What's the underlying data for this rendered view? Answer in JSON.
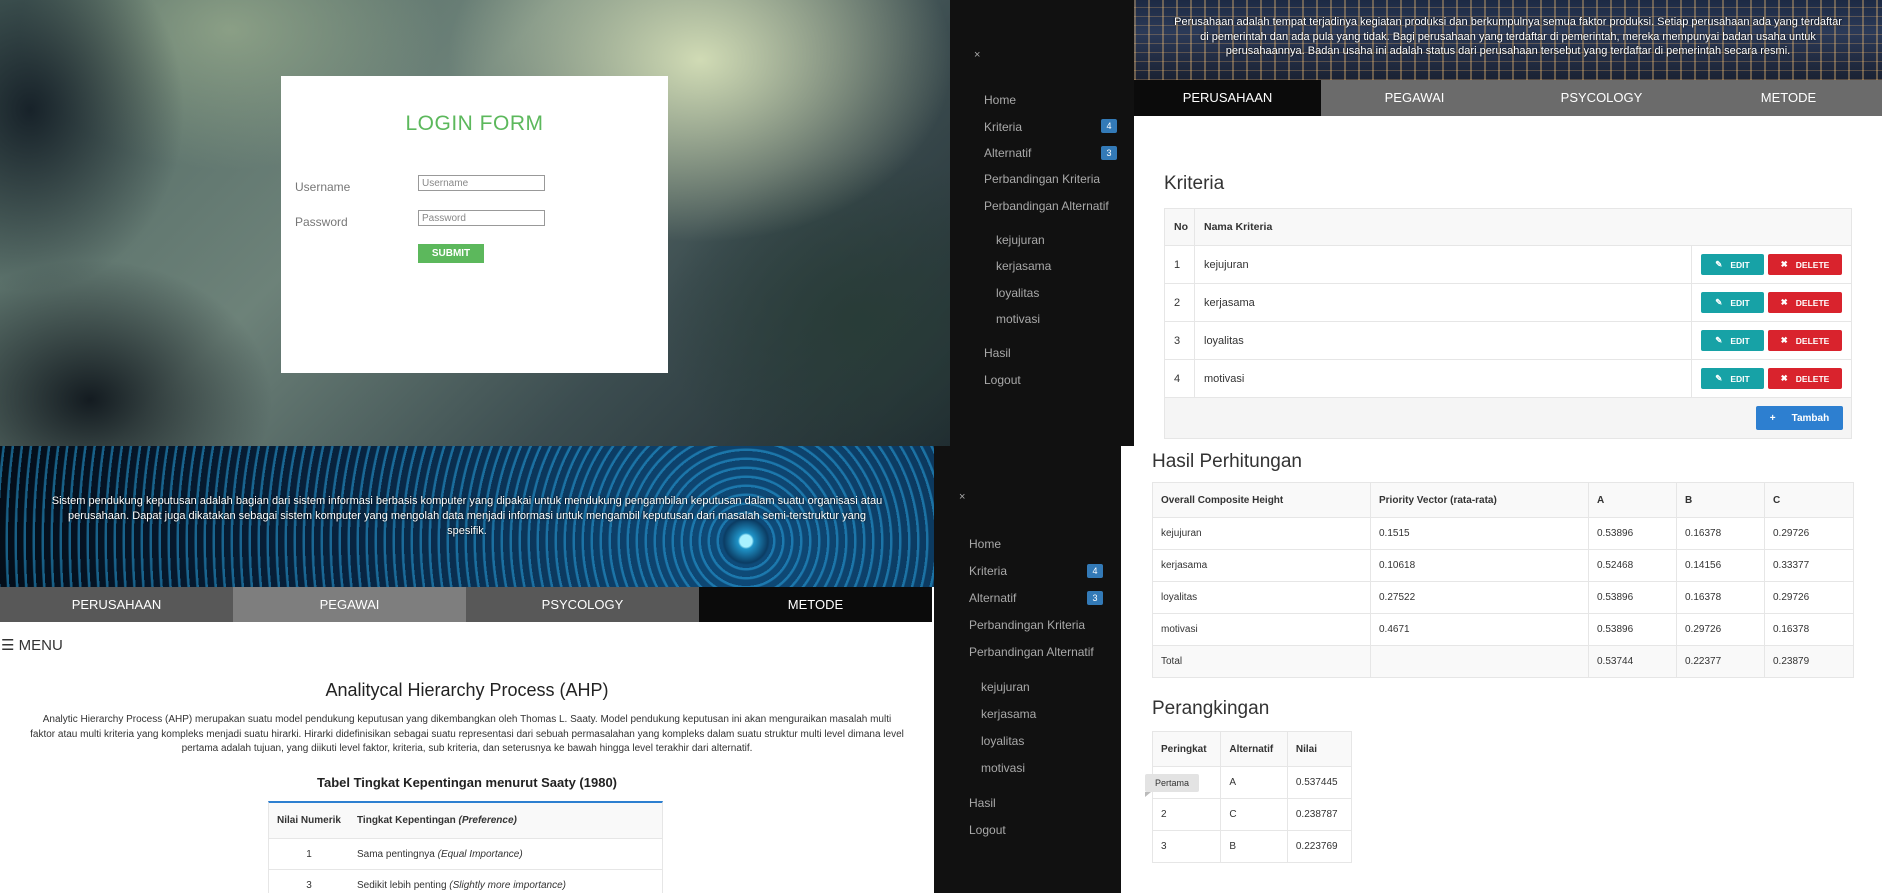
{
  "login": {
    "title": "LOGIN FORM",
    "username_label": "Username",
    "username_placeholder": "Username",
    "password_label": "Password",
    "password_placeholder": "Password",
    "submit_label": "SUBMIT",
    "accent_color": "#5cb85c"
  },
  "sidebar": {
    "close_symbol": "×",
    "items": [
      {
        "label": "Home"
      },
      {
        "label": "Kriteria",
        "badge": "4"
      },
      {
        "label": "Alternatif",
        "badge": "3"
      },
      {
        "label": "Perbandingan Kriteria"
      },
      {
        "label": "Perbandingan Alternatif"
      }
    ],
    "sub_items": [
      "kejujuran",
      "kerjasama",
      "loyalitas",
      "motivasi"
    ],
    "bottom_items": [
      "Hasil",
      "Logout"
    ],
    "badge_color": "#337ab7"
  },
  "tabs": [
    "PERUSAHAAN",
    "PEGAWAI",
    "PSYCOLOGY",
    "METODE"
  ],
  "kriteria_page": {
    "hero_text": "Perusahaan adalah tempat terjadinya kegiatan produksi dan berkumpulnya semua faktor produksi. Setiap perusahaan ada yang terdaftar di pemerintah dan ada pula yang tidak. Bagi perusahaan yang terdaftar di pemerintah, mereka mempunyai badan usaha untuk perusahaannya. Badan usaha ini adalah status dari perusahaan tersebut yang terdaftar di pemerintah secara resmi.",
    "title": "Kriteria",
    "col_no": "No",
    "col_name": "Nama Kriteria",
    "rows": [
      {
        "no": "1",
        "name": "kejujuran"
      },
      {
        "no": "2",
        "name": "kerjasama"
      },
      {
        "no": "3",
        "name": "loyalitas"
      },
      {
        "no": "4",
        "name": "motivasi"
      }
    ],
    "edit_label": "EDIT",
    "delete_label": "DELETE",
    "add_label": "Tambah",
    "edit_color": "#17a2a6",
    "delete_color": "#d9232d",
    "add_color": "#2d7fd0"
  },
  "ahp_page": {
    "hero_text": "Sistem pendukung keputusan adalah bagian dari sistem informasi berbasis komputer yang dipakai untuk mendukung pengambilan keputusan dalam suatu organisasi atau perusahaan. Dapat juga dikatakan sebagai sistem komputer yang mengolah data menjadi informasi untuk mengambil keputusan dari masalah semi-terstruktur yang spesifik.",
    "menu_label": "☰ MENU",
    "title": "Analitycal Hierarchy Process (AHP)",
    "description": "Analytic Hierarchy Process (AHP) merupakan suatu model pendukung keputusan yang dikembangkan oleh Thomas L. Saaty. Model pendukung keputusan ini akan menguraikan masalah multi faktor atau multi kriteria yang kompleks menjadi suatu hirarki. Hirarki didefinisikan sebagai suatu representasi dari sebuah permasalahan yang kompleks dalam suatu struktur multi level dimana level pertama adalah tujuan, yang diikuti level faktor, kriteria, sub kriteria, dan seterusnya ke bawah hingga level terakhir dari alternatif.",
    "table_title": "Tabel Tingkat Kepentingan menurut Saaty (1980)",
    "col_value": "Nilai Numerik",
    "col_importance": "Tingkat Kepentingan",
    "col_importance_en": "(Preference)",
    "rows": [
      {
        "value": "1",
        "label": "Sama pentingnya",
        "label_en": "(Equal Importance)"
      },
      {
        "value": "3",
        "label": "Sedikit lebih penting",
        "label_en": "(Slightly more importance)"
      }
    ]
  },
  "hasil_page": {
    "title": "Hasil Perhitungan",
    "headers": [
      "Overall Composite Height",
      "Priority Vector (rata-rata)",
      "A",
      "B",
      "C"
    ],
    "rows": [
      {
        "name": "kejujuran",
        "pv": "0.1515",
        "a": "0.53896",
        "b": "0.16378",
        "c": "0.29726"
      },
      {
        "name": "kerjasama",
        "pv": "0.10618",
        "a": "0.52468",
        "b": "0.14156",
        "c": "0.33377"
      },
      {
        "name": "loyalitas",
        "pv": "0.27522",
        "a": "0.53896",
        "b": "0.16378",
        "c": "0.29726"
      },
      {
        "name": "motivasi",
        "pv": "0.4671",
        "a": "0.53896",
        "b": "0.29726",
        "c": "0.16378"
      }
    ],
    "total": {
      "name": "Total",
      "a": "0.53744",
      "b": "0.22377",
      "c": "0.23879"
    },
    "ranking_title": "Perangkingan",
    "ranking_headers": [
      "Peringkat",
      "Alternatif",
      "Nilai"
    ],
    "ranking": [
      {
        "rank": "Pertama",
        "alt": "A",
        "value": "0.537445"
      },
      {
        "rank": "2",
        "alt": "C",
        "value": "0.238787"
      },
      {
        "rank": "3",
        "alt": "B",
        "value": "0.223769"
      }
    ]
  }
}
